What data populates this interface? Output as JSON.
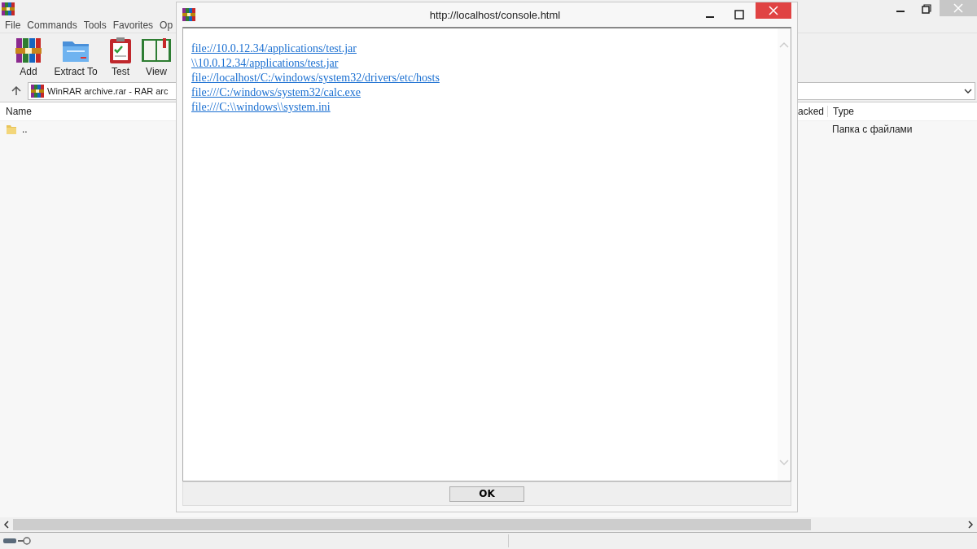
{
  "menu": [
    "File",
    "Commands",
    "Tools",
    "Favorites",
    "Op"
  ],
  "toolbar": [
    {
      "label": "Add",
      "kind": "add"
    },
    {
      "label": "Extract To",
      "kind": "extract"
    },
    {
      "label": "Test",
      "kind": "test"
    },
    {
      "label": "View",
      "kind": "view"
    }
  ],
  "address": {
    "value": "WinRAR archive.rar - RAR arc"
  },
  "columns": [
    "Name",
    "acked",
    "Type"
  ],
  "rows": [
    {
      "name": "..",
      "type": "Папка с файлами"
    }
  ],
  "dialog": {
    "title": "http://localhost/console.html",
    "links": [
      "file://10.0.12.34/applications/test.jar",
      "\\\\10.0.12.34/applications/test.jar",
      "file://localhost/C:/windows/system32/drivers/etc/hosts",
      "file:///C:/windows/system32/calc.exe",
      "file:///C:\\\\windows\\\\system.ini"
    ],
    "button": "OK"
  }
}
